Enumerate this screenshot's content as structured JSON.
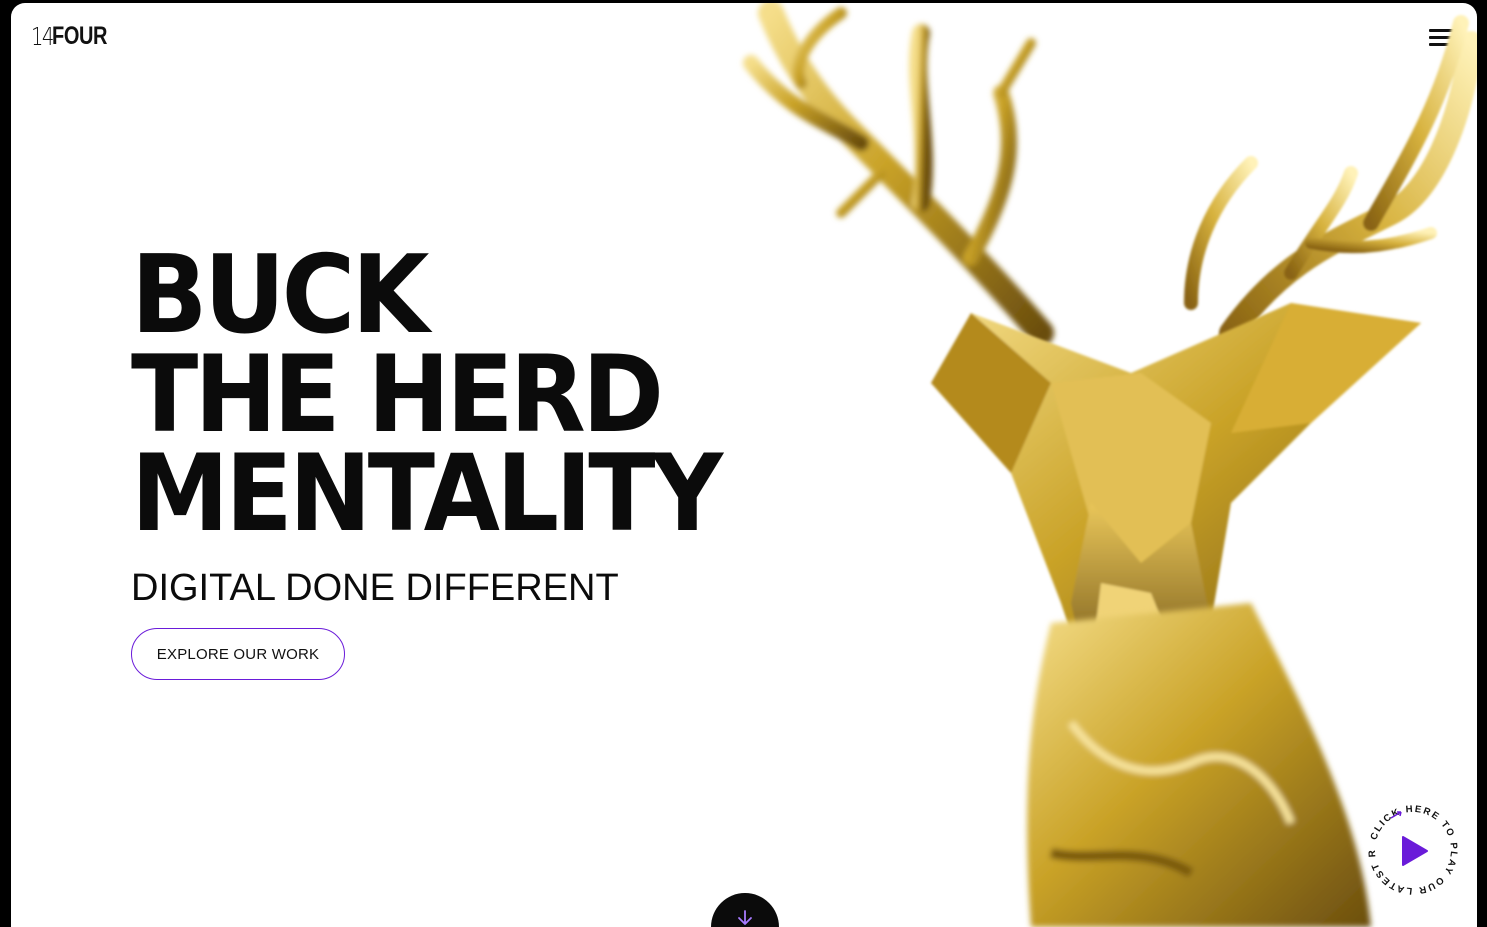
{
  "logo": {
    "number": "14",
    "word": "FOUR"
  },
  "nav": {
    "menu_icon": "hamburger-menu-icon"
  },
  "hero": {
    "headline_lines": [
      "BUCK",
      "THE HERD",
      "MENTALITY"
    ],
    "subheadline": "DIGITAL DONE DIFFERENT",
    "cta_label": "EXPLORE OUR WORK",
    "image": "gold-low-poly-stag-head"
  },
  "reel_badge": {
    "text": "CLICK HERE TO PLAY OUR LATEST REEL",
    "icon": "play-icon"
  },
  "scroll_button": {
    "icon": "arrow-down-icon"
  },
  "colors": {
    "accent": "#6a1bd9",
    "text": "#0b0b0b",
    "background": "#ffffff",
    "gold": "#c9a227"
  }
}
